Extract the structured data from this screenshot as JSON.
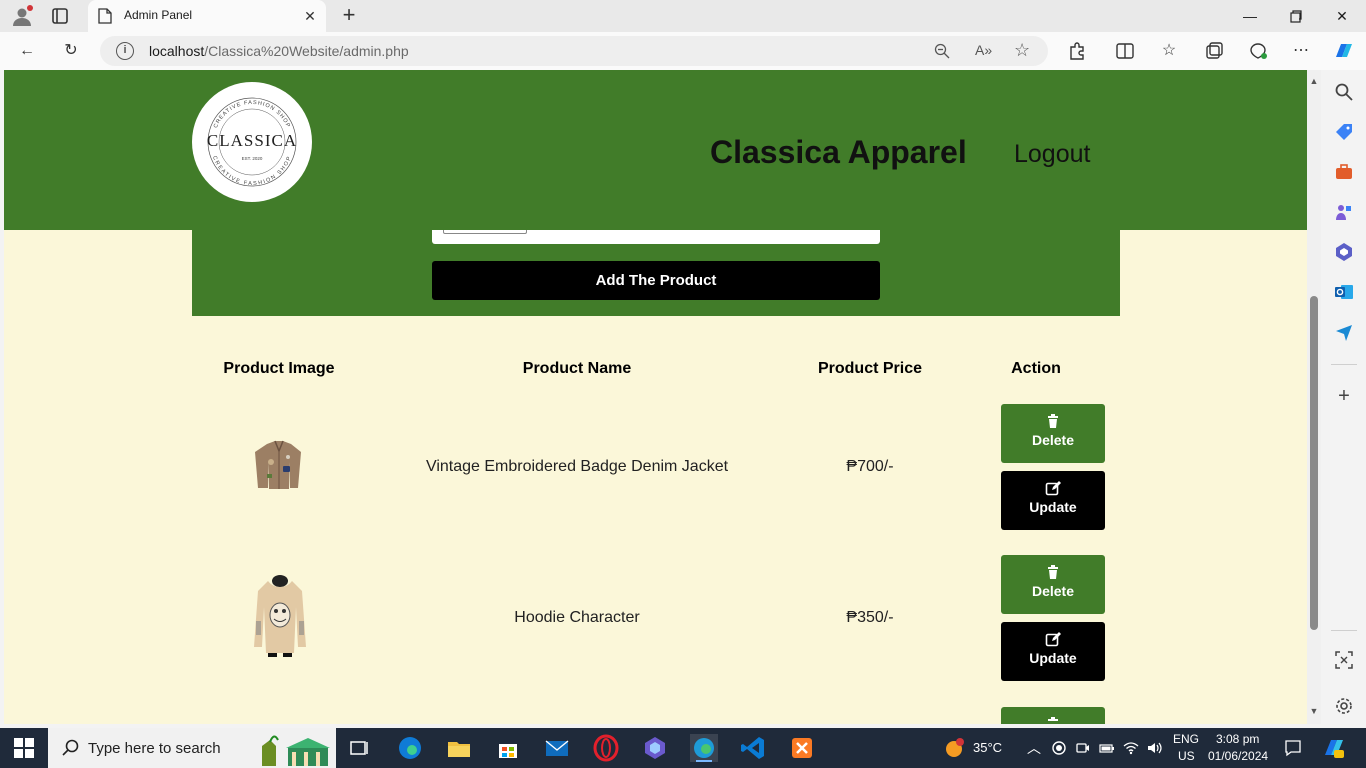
{
  "browser": {
    "tab_title": "Admin Panel",
    "url_host": "localhost",
    "url_path": "/Classica%20Website/admin.php"
  },
  "header": {
    "logo": {
      "text": "CLASSICA",
      "ring_top": "CREATIVE FASHION SHOP",
      "ring_bottom": "CREATIVE FASHION SHOP",
      "est": "EST. 2020"
    },
    "brand": "Classica Apparel",
    "logout": "Logout"
  },
  "form": {
    "add_button": "Add The Product"
  },
  "table": {
    "headers": [
      "Product Image",
      "Product Name",
      "Product Price",
      "Action"
    ],
    "rows": [
      {
        "image": "denim-jacket-image",
        "name": "Vintage Embroidered Badge Denim Jacket",
        "price": "₱700/-",
        "delete": "Delete",
        "update": "Update"
      },
      {
        "image": "hoodie-image",
        "name": "Hoodie Character",
        "price": "₱350/-",
        "delete": "Delete",
        "update": "Update"
      }
    ]
  },
  "taskbar": {
    "search_placeholder": "Type here to search",
    "weather": "35°C",
    "lang": "ENG",
    "region": "US",
    "time": "3:08 pm",
    "date": "01/06/2024"
  },
  "colors": {
    "header_green": "#417c29",
    "page_bg": "#fbf7d9",
    "button_black": "#000000"
  }
}
